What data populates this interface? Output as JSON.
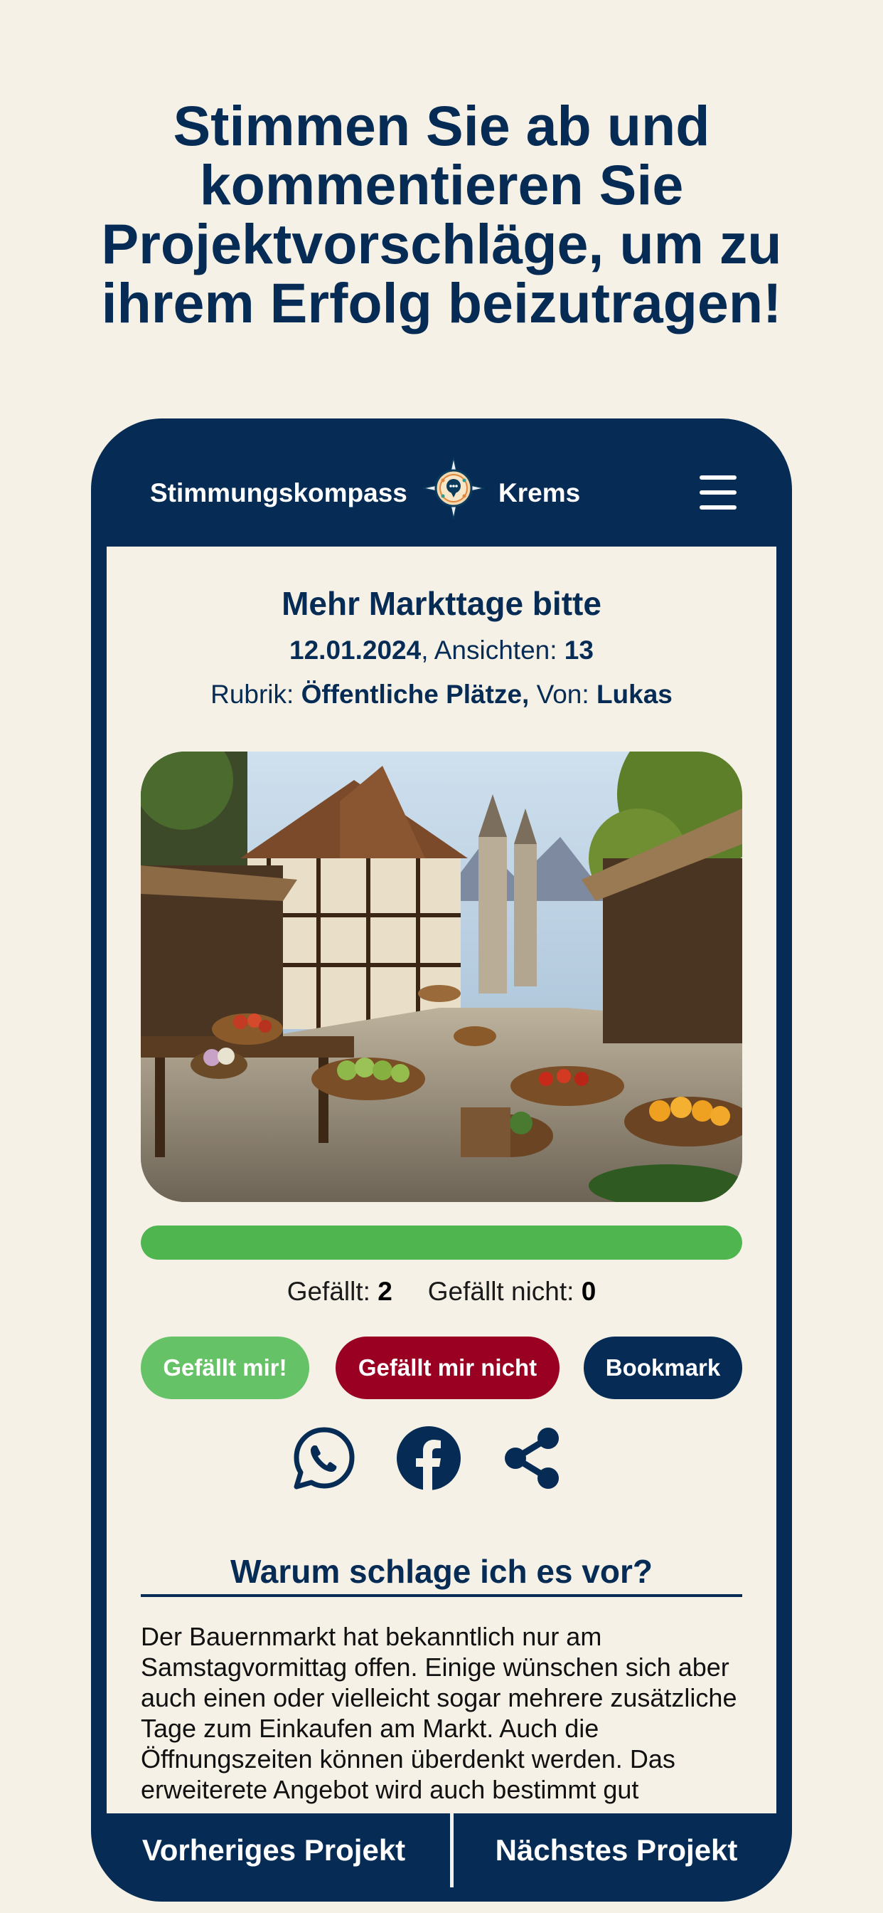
{
  "headline": "Stimmen Sie ab und kommentieren Sie Projektvorschläge, um zu ihrem Erfolg beizutragen!",
  "header": {
    "brand_left": "Stimmungskompass",
    "brand_right": "Krems",
    "logo_icon": "compass-logo-icon",
    "menu_icon": "hamburger-menu-icon"
  },
  "project": {
    "title": "Mehr Markttage bitte",
    "date": "12.01.2024",
    "views_label": ", Ansichten: ",
    "views": "13",
    "category_label": "Rubrik: ",
    "category": "Öffentliche Plätze,",
    "author_label": " Von: ",
    "author": "Lukas",
    "image_alt": "Marktplatz mit Obst- und Gemüseständen"
  },
  "voting": {
    "like_ratio": 1.0,
    "likes_label": "Gefällt: ",
    "likes": "2",
    "dislikes_label": "Gefällt nicht: ",
    "dislikes": "0",
    "like_button": "Gefällt mir!",
    "dislike_button": "Gefällt mir nicht",
    "bookmark_button": "Bookmark"
  },
  "share": {
    "icons": [
      "whatsapp-icon",
      "facebook-icon",
      "share-icon"
    ]
  },
  "reason": {
    "heading": "Warum schlage ich es vor?",
    "text": "Der Bauernmarkt hat bekanntlich nur am Samstagvormittag offen. Einige wünschen sich aber auch einen oder vielleicht sogar mehrere zusätzliche Tage zum Einkaufen am Markt. Auch die Öffnungszeiten können überdenkt werden. Das erweiterete Angebot wird auch bestimmt gut"
  },
  "nav": {
    "prev": "Vorheriges Projekt",
    "next": "Nächstes Projekt"
  },
  "colors": {
    "background": "#f5f1e6",
    "navy": "#062c55",
    "like_green": "#66c266",
    "progress_green": "#4fb54f",
    "dislike_red": "#9a0022"
  }
}
